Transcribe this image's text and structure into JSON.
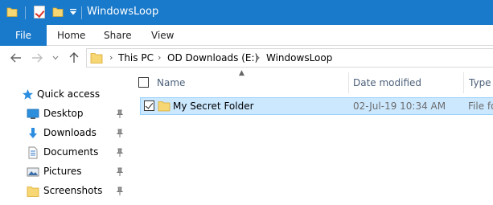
{
  "window": {
    "title": "WindowsLoop"
  },
  "quick_access_toolbar": {
    "icons": [
      "folder-icon",
      "properties-check-icon",
      "new-folder-icon",
      "customize-dropdown-icon"
    ]
  },
  "ribbon": {
    "tabs": [
      {
        "label": "File",
        "active": true
      },
      {
        "label": "Home"
      },
      {
        "label": "Share"
      },
      {
        "label": "View"
      }
    ]
  },
  "address": {
    "crumbs": [
      "This PC",
      "OD Downloads (E:)",
      "WindowsLoop"
    ]
  },
  "nav_pane": {
    "quick_access_label": "Quick access",
    "items": [
      {
        "label": "Desktop",
        "icon": "desktop-icon",
        "pinned": true
      },
      {
        "label": "Downloads",
        "icon": "downloads-icon",
        "pinned": true
      },
      {
        "label": "Documents",
        "icon": "documents-icon",
        "pinned": true
      },
      {
        "label": "Pictures",
        "icon": "pictures-icon",
        "pinned": true
      },
      {
        "label": "Screenshots",
        "icon": "folder-icon",
        "pinned": true
      }
    ]
  },
  "file_list": {
    "columns": {
      "name": "Name",
      "date": "Date modified",
      "type": "Type"
    },
    "rows": [
      {
        "name": "My Secret Folder",
        "date": "02-Jul-19 10:34 AM",
        "type": "File fo",
        "selected": true,
        "checked": true
      }
    ]
  },
  "colors": {
    "title_bar": "#1979ca",
    "selection": "#cce8ff",
    "selection_border": "#99d1ff",
    "folder": "#f7d674"
  }
}
